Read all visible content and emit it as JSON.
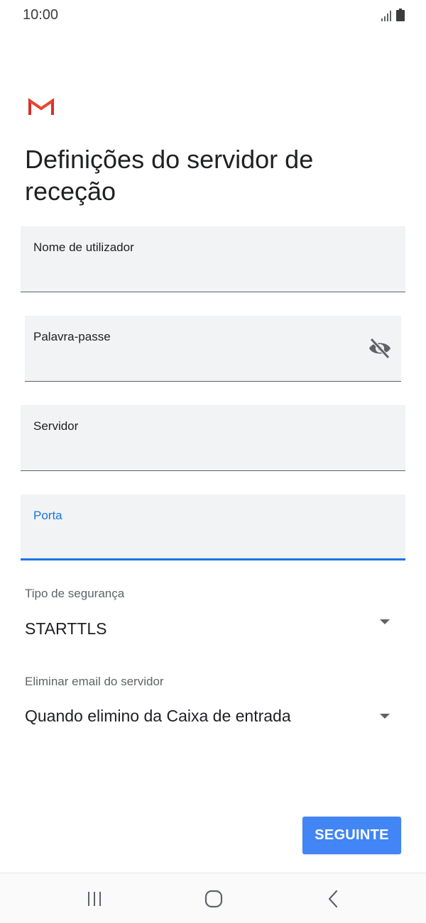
{
  "status_bar": {
    "time": "10:00"
  },
  "title": "Definições do servidor de receção",
  "fields": {
    "username": {
      "label": "Nome de utilizador",
      "value": ""
    },
    "password": {
      "label": "Palavra-passe",
      "value": ""
    },
    "server": {
      "label": "Servidor",
      "value": ""
    },
    "port": {
      "label": "Porta",
      "value": ""
    }
  },
  "security": {
    "label": "Tipo de segurança",
    "value": "STARTTLS"
  },
  "delete_email": {
    "label": "Eliminar email do servidor",
    "value": "Quando elimino da Caixa de entrada"
  },
  "next_button": "SEGUINTE",
  "colors": {
    "accent": "#1a73e8",
    "button": "#4285f4",
    "field_bg": "#f1f3f4",
    "gmail_red": "#d93025"
  },
  "icons": {
    "password_toggle": "eye-off-icon",
    "recents": "recents-icon",
    "home": "home-icon",
    "back": "back-icon"
  }
}
